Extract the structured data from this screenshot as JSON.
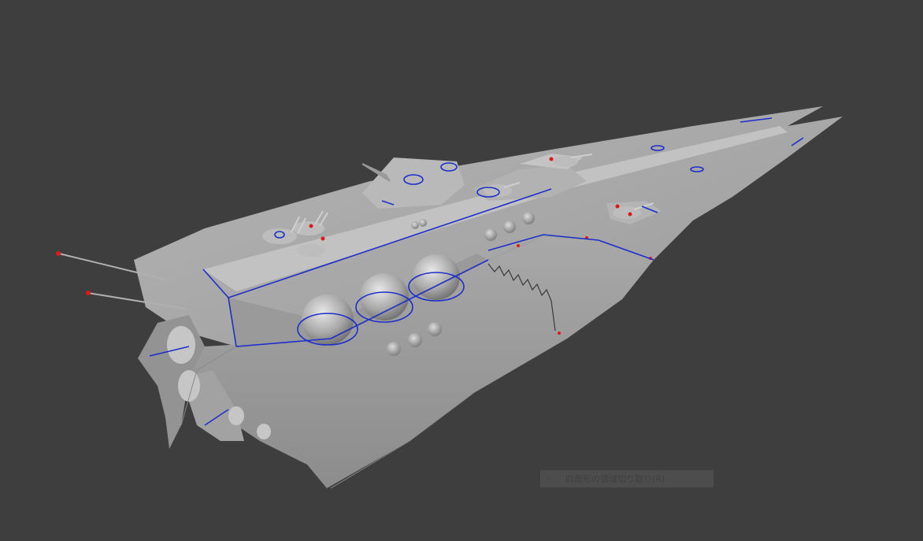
{
  "viewport": {
    "background_color": "#3e3e3e",
    "model_color": "#a9a9a9",
    "edge_highlight_color": "#1e2fc8",
    "marker_color": "#e01818"
  },
  "status_hint": {
    "icon": "bullet-icon",
    "text": "四角形の領域切り取り(R)"
  }
}
